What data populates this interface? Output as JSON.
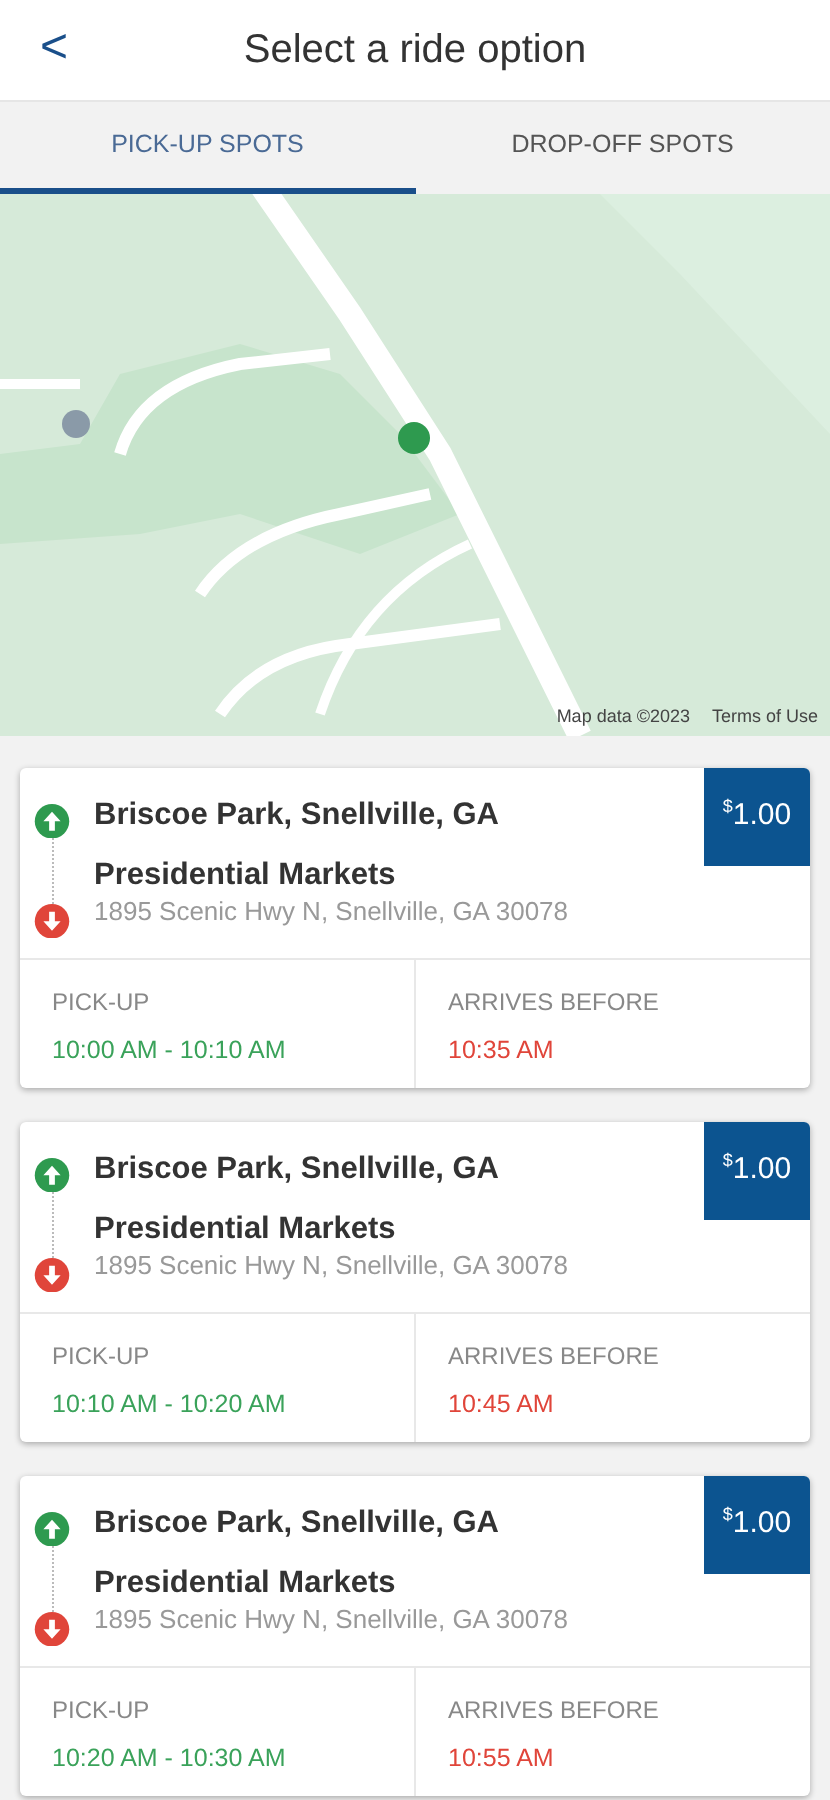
{
  "header": {
    "back": "<",
    "title": "Select a ride option"
  },
  "tabs": [
    {
      "label": "PICK-UP SPOTS",
      "selected": true
    },
    {
      "label": "DROP-OFF SPOTS",
      "selected": false
    }
  ],
  "map": {
    "kind": "picture",
    "attribution": "Map data ©2023",
    "terms": "Terms of Use"
  },
  "rides": [
    {
      "origin": "Briscoe Park, Snellville, GA",
      "destination": "Presidential Markets",
      "address": "1895 Scenic Hwy N, Snellville, GA 30078",
      "currency": "$",
      "price": "1.00",
      "pickup_label": "PICK-UP",
      "pickup": "10:00 AM - 10:10 AM",
      "arrive_label": "ARRIVES BEFORE",
      "arrive": "10:35 AM"
    },
    {
      "origin": "Briscoe Park, Snellville, GA",
      "destination": "Presidential Markets",
      "address": "1895 Scenic Hwy N, Snellville, GA 30078",
      "currency": "$",
      "price": "1.00",
      "pickup_label": "PICK-UP",
      "pickup": "10:10 AM - 10:20 AM",
      "arrive_label": "ARRIVES BEFORE",
      "arrive": "10:45 AM"
    },
    {
      "origin": "Briscoe Park, Snellville, GA",
      "destination": "Presidential Markets",
      "address": "1895 Scenic Hwy N, Snellville, GA 30078",
      "currency": "$",
      "price": "1.00",
      "pickup_label": "PICK-UP",
      "pickup": "10:20 AM - 10:30 AM",
      "arrive_label": "ARRIVES BEFORE",
      "arrive": "10:55 AM"
    }
  ]
}
